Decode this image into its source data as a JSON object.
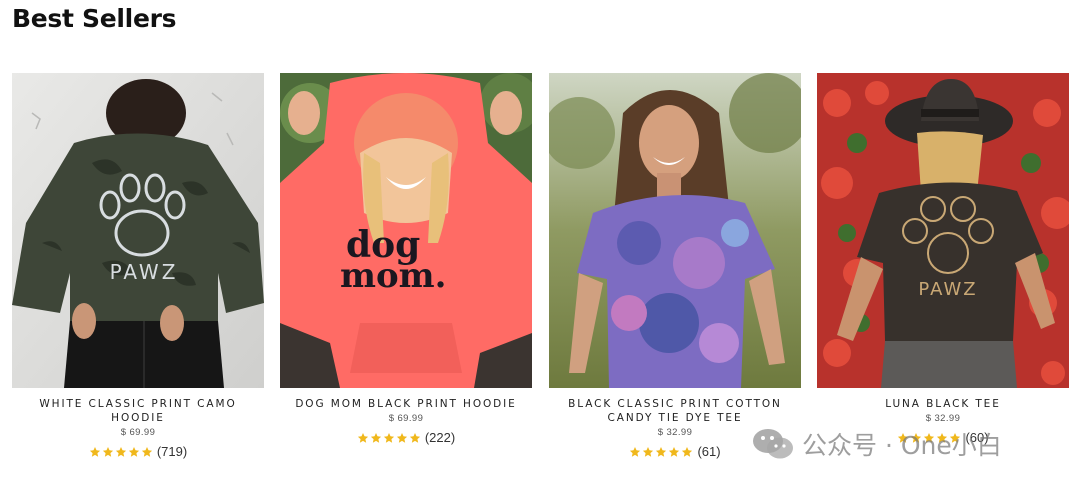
{
  "section": {
    "title": "Best Sellers"
  },
  "colors": {
    "star": "#f0b81c",
    "title": "#111111",
    "text": "#222222"
  },
  "products": [
    {
      "name": "WHITE CLASSIC PRINT CAMO HOODIE",
      "price": "$ 69.99",
      "rating": 5,
      "reviews": "(719)"
    },
    {
      "name": "DOG MOM BLACK PRINT HOODIE",
      "price": "$ 69.99",
      "rating": 5,
      "reviews": "(222)",
      "print_text": [
        "dog",
        "mom."
      ]
    },
    {
      "name": "BLACK CLASSIC PRINT COTTON CANDY TIE DYE TEE",
      "price": "$ 32.99",
      "rating": 5,
      "reviews": "(61)"
    },
    {
      "name": "LUNA BLACK TEE",
      "price": "$ 32.99",
      "rating": 5,
      "reviews": "(60)"
    }
  ],
  "watermark": {
    "text": "公众号 · One小白",
    "icon": "wechat-icon"
  }
}
